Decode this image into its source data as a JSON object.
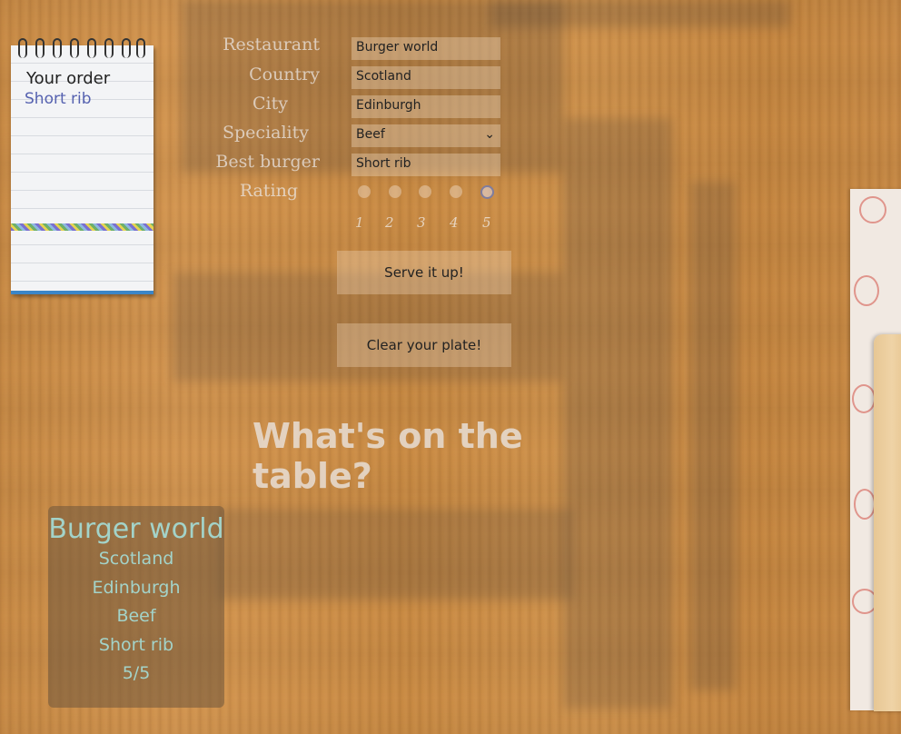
{
  "notepad": {
    "title": "Your order",
    "item": "Short rib"
  },
  "form": {
    "restaurant_label": "Restaurant",
    "restaurant_value": "Burger world",
    "country_label": "Country",
    "country_value": "Scotland",
    "city_label": "City",
    "city_value": "Edinburgh",
    "speciality_label": "Speciality",
    "speciality_value": "Beef",
    "best_burger_label": "Best burger",
    "best_burger_value": "Short rib",
    "rating_label": "Rating",
    "rating_options": [
      "1",
      "2",
      "3",
      "4",
      "5"
    ],
    "rating_selected": 5
  },
  "buttons": {
    "serve": "Serve it up!",
    "clear": "Clear your plate!"
  },
  "headline": "What's on the table?",
  "summary": {
    "restaurant": "Burger world",
    "country": "Scotland",
    "city": "Edinburgh",
    "speciality": "Beef",
    "best_burger": "Short rib",
    "rating": "5/5"
  }
}
